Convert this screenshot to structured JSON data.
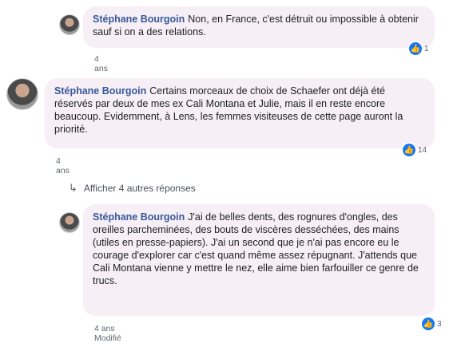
{
  "comments": [
    {
      "author": "Stéphane Bourgoin",
      "text": "Non, en France, c'est détruit ou impossible à obtenir sauf si on a des relations.",
      "time": "4 ans",
      "reactions": "1"
    },
    {
      "author": "Stéphane Bourgoin",
      "text": "Certains morceaux de choix de Schaefer ont déjà été réservés par deux de mes ex Cali Montana et Julie, mais il en reste encore beaucoup. Evidemment, à Lens, les femmes visiteuses de cette page auront la priorité.",
      "time": "4 ans",
      "reactions": "14"
    },
    {
      "author": "Stéphane Bourgoin",
      "text": "J'ai de belles dents, des rognures d'ongles, des oreilles parcheminées, des bouts de viscères desséchées, des mains (utiles en presse-papiers). J'ai un second que je n'ai pas encore eu le courage d'explorer car c'est quand même assez répugnant. J'attends que Cali Montana vienne y mettre le nez, elle aime bien farfouiller ce genre de trucs.",
      "time": "4 ans",
      "edited": "Modifié",
      "reactions": "3"
    }
  ],
  "replies_link": "Afficher 4 autres réponses",
  "icons": {
    "reply_arrow": "reply-arrow-icon",
    "like": "like-icon"
  },
  "colors": {
    "author": "#385898",
    "bubble": "#f6eff6",
    "like": "#1877f2"
  }
}
